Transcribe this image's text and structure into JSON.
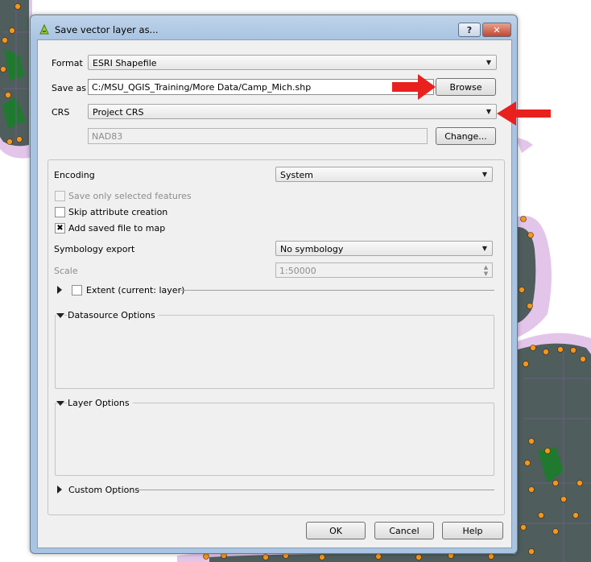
{
  "dialog": {
    "title": "Save vector layer as...",
    "help_label": "?",
    "close_label": "✕",
    "format_label": "Format",
    "format_value": "ESRI Shapefile",
    "saveas_label": "Save as",
    "saveas_value": "C:/MSU_QGIS_Training/More Data/Camp_Mich.shp",
    "browse_label": "Browse",
    "crs_label": "CRS",
    "crs_value": "Project CRS",
    "crs_name": "NAD83",
    "change_label": "Change...",
    "encoding_label": "Encoding",
    "encoding_value": "System",
    "save_selected_label": "Save only selected features",
    "skip_attr_label": "Skip attribute creation",
    "add_to_map_label": "Add saved file to map",
    "add_to_map_checked_glyph": "✖",
    "symbology_label": "Symbology export",
    "symbology_value": "No symbology",
    "scale_label": "Scale",
    "scale_value": "1:50000",
    "extent_label": "Extent (current: layer)",
    "datasource_label": "Datasource Options",
    "layer_options_label": "Layer Options",
    "custom_options_label": "Custom Options",
    "ok_label": "OK",
    "cancel_label": "Cancel",
    "help_button_label": "Help"
  },
  "colors": {
    "annotation_arrow": "#e8211f",
    "map_fill": "#4f5d5d",
    "map_buffer": "#e3c5ea",
    "map_points": "#f7951d",
    "map_green": "#1f7a2f"
  },
  "icons": {
    "title_icon": "qgis-icon",
    "combo_arrow": "dropdown-arrow-icon",
    "expand": "triangle-right-icon",
    "collapse": "triangle-down-icon"
  }
}
